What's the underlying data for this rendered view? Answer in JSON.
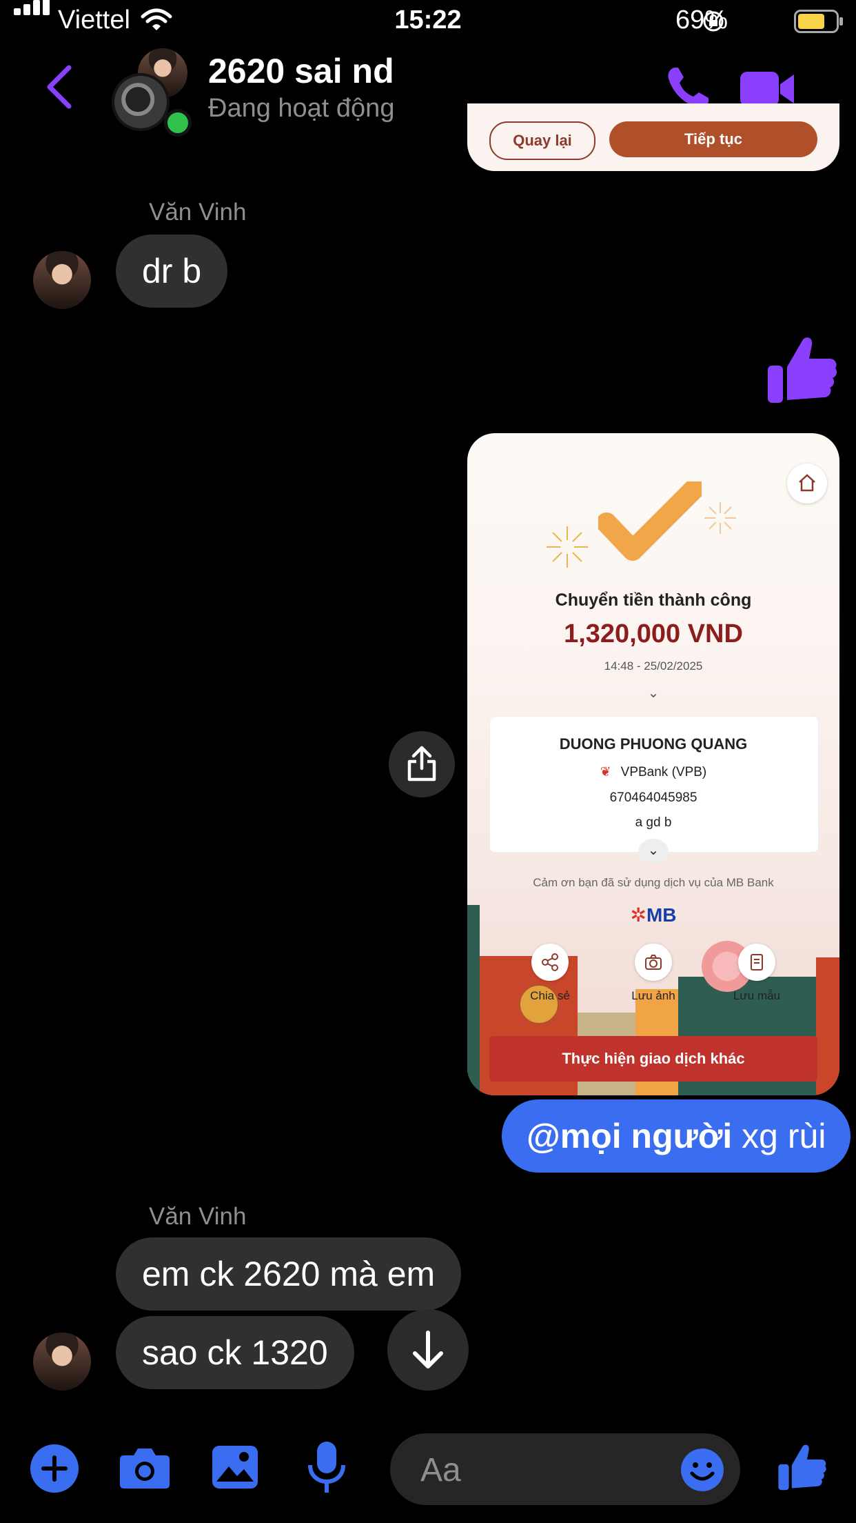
{
  "status_bar": {
    "carrier": "Viettel",
    "time": "15:22",
    "battery": "69%"
  },
  "header": {
    "title": "2620 sai nd",
    "status": "Đang hoạt động"
  },
  "prev_card": {
    "back_label": "Quay lại",
    "continue_label": "Tiếp tục"
  },
  "messages": {
    "m1_sender": "Văn Vinh",
    "m1_text": "dr b",
    "m2_sender": "Văn Vinh",
    "m2_line1": "em ck 2620 mà em",
    "m2_line2": "sao ck 1320",
    "my_msg_mention": "@mọi người",
    "my_msg_text": " xg rùi"
  },
  "receipt": {
    "title": "Chuyển tiền thành công",
    "amount": "1,320,000 VND",
    "datetime": "14:48 - 25/02/2025",
    "recipient_name": "DUONG PHUONG QUANG",
    "bank": "VPBank (VPB)",
    "account": "670464045985",
    "note": "a gd b",
    "thanks": "Cảm ơn bạn đã sử dụng dịch vụ của MB Bank",
    "brand": "MB",
    "action_share": "Chia sẻ",
    "action_save_image": "Lưu ảnh",
    "action_save_template": "Lưu mẫu",
    "other_tx": "Thực hiện giao dịch khác"
  },
  "composer": {
    "placeholder": "Aa"
  },
  "colors": {
    "accent": "#8a3ffc",
    "blue": "#3a6df0",
    "amount": "#8b1d1d"
  }
}
